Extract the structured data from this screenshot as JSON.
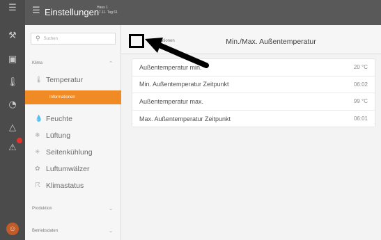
{
  "rail": {
    "icons": [
      "menu-icon",
      "tools-icon",
      "device-icon",
      "thermometer-icon",
      "gauge-icon",
      "bell-icon",
      "alert-icon"
    ],
    "glyphs": [
      "☰",
      "⚒",
      "▣",
      "🌡",
      "◔",
      "△",
      "⚠"
    ],
    "avatar_glyph": "☺"
  },
  "topbar": {
    "icon": "☰",
    "title": "Einstellungen",
    "sub_line1": "Haus 1",
    "sub_line2": "17.11. Tag 61"
  },
  "sidebar": {
    "search_placeholder": "Suchen",
    "group_klima": "Klima",
    "group_produktion": "Produktion",
    "group_betriebsdaten": "Betriebsdaten",
    "items": [
      {
        "label": "Temperatur",
        "icon": "🌡"
      },
      {
        "label": "Feuchte",
        "icon": "💧"
      },
      {
        "label": "Lüftung",
        "icon": "❄"
      },
      {
        "label": "Seitenkühlung",
        "icon": "✳"
      },
      {
        "label": "Luftumwälzer",
        "icon": "✿"
      },
      {
        "label": "Klimastatus",
        "icon": "☈"
      }
    ],
    "active_sub": "Informationen"
  },
  "content": {
    "breadcrumb": "Informationen",
    "title": "Min./Max. Außentemperatur",
    "rows": [
      {
        "label": "Außentemperatur min.",
        "value": "20 °C"
      },
      {
        "label": "Min. Außentemperatur Zeitpunkt",
        "value": "06:02"
      },
      {
        "label": "Außentemperatur max.",
        "value": "99 °C"
      },
      {
        "label": "Max. Außentemperatur Zeitpunkt",
        "value": "06:01"
      }
    ]
  },
  "colors": {
    "accent": "#f08a24",
    "rail": "#4b4b4b",
    "topbar": "#595959",
    "annotation": "#000000"
  }
}
